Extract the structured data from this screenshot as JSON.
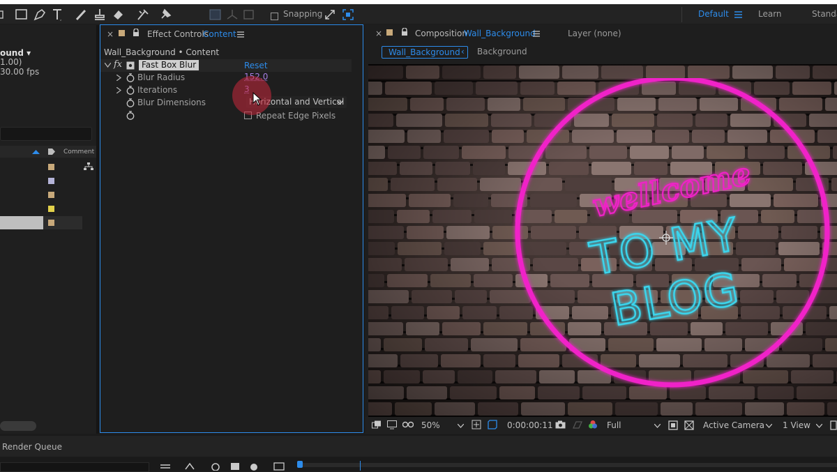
{
  "toolbar": {
    "snapping_label": "Snapping",
    "workspaces": [
      "Default",
      "Learn",
      "Standa"
    ],
    "active_workspace_index": 0
  },
  "project_panel": {
    "comp_name_partial": "ound ▾",
    "line2": "1.00)",
    "line3": "30.00 fps",
    "comment_header": "Comment",
    "label_colors": [
      "#c8a97a",
      "#b5b4d8",
      "#c8a97a",
      "#e2d14a",
      "#c8a97a"
    ]
  },
  "effect_controls": {
    "tab_title": "Effect Controls",
    "tab_layer": "Content",
    "breadcrumb": "Wall_Background • Content",
    "effect_name": "Fast Box Blur",
    "reset_label": "Reset",
    "properties": [
      {
        "name": "Blur Radius",
        "value": "152.0"
      },
      {
        "name": "Iterations",
        "value": "3"
      },
      {
        "name": "Blur Dimensions",
        "value": "Horizontal and Vertical"
      }
    ],
    "repeat_edge_label": "Repeat Edge Pixels"
  },
  "composition": {
    "tab_title": "Composition",
    "tab_comp": "Wall_Background",
    "layer_tab": "Layer (none)",
    "breadcrumb_active": "Wall_Background",
    "breadcrumb_next": "Background",
    "neon_line1": "wellcome",
    "neon_line2": "TO MY",
    "neon_line3": "BLOG"
  },
  "viewer_bar": {
    "zoom": "50%",
    "timecode": "0:00:00:11",
    "resolution": "Full",
    "camera": "Active Camera",
    "views": "1 View"
  },
  "bottom": {
    "render_queue_label": "Render Queue"
  },
  "colors": {
    "accent_blue": "#2d8ceb",
    "neon_pink": "#f020c8",
    "neon_cyan": "#3ad6ee",
    "value_purple": "#a57ee0"
  }
}
